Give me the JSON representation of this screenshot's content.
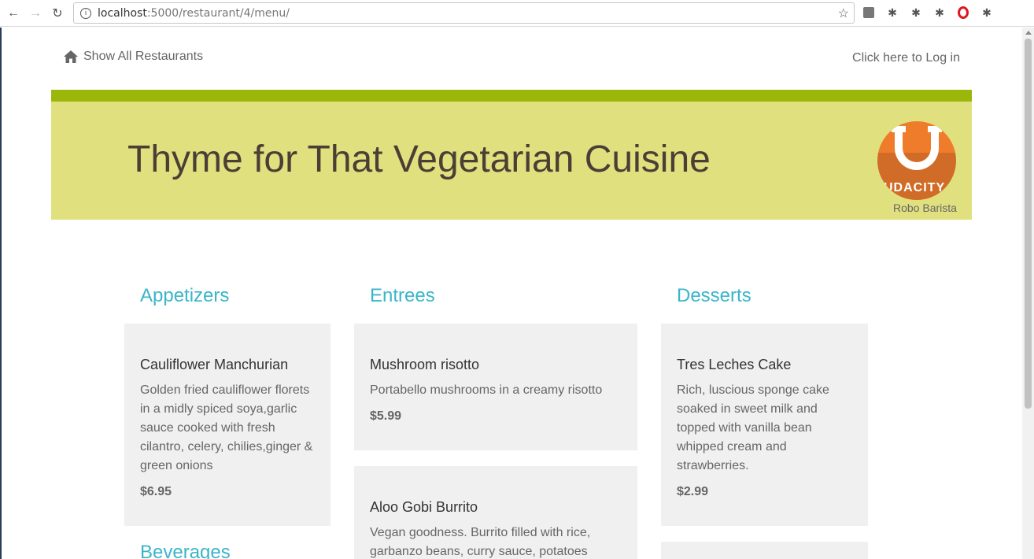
{
  "browser": {
    "url_host": "localhost",
    "url_path": ":5000/restaurant/4/menu/"
  },
  "nav": {
    "home_label": "Show All Restaurants",
    "login_label": "Click here to Log in"
  },
  "banner": {
    "title": "Thyme for That Vegetarian Cuisine",
    "avatar_brand": "UDACITY",
    "avatar_caption": "Robo Barista"
  },
  "menu": {
    "appetizers": {
      "heading": "Appetizers",
      "items": [
        {
          "name": "Cauliflower Manchurian",
          "description": "Golden fried cauliflower florets in a midly spiced soya,garlic sauce cooked with fresh cilantro, celery, chilies,ginger & green onions",
          "price": "$6.95"
        }
      ]
    },
    "beverages": {
      "heading": "Beverages"
    },
    "entrees": {
      "heading": "Entrees",
      "items": [
        {
          "name": "Mushroom risotto",
          "description": "Portabello mushrooms in a creamy risotto",
          "price": "$5.99"
        },
        {
          "name": "Aloo Gobi Burrito",
          "description": "Vegan goodness. Burrito filled with rice, garbanzo beans, curry sauce, potatoes"
        }
      ]
    },
    "desserts": {
      "heading": "Desserts",
      "items": [
        {
          "name": "Tres Leches Cake",
          "description": "Rich, luscious sponge cake soaked in sweet milk and topped with vanilla bean whipped cream and strawberries.",
          "price": "$2.99"
        }
      ]
    }
  }
}
